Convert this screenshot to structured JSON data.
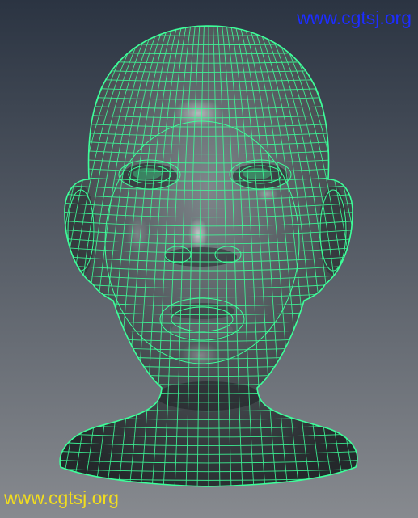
{
  "watermarks": {
    "top_right": "www.cgtsj.org",
    "bottom_left": "www.cgtsj.org"
  },
  "colors": {
    "background_top": "#2b3442",
    "background_bottom": "#878a8f",
    "mesh_wire": "#3dff9a",
    "skin_shade": "#4b5054",
    "top_watermark": "#1d2dff",
    "bottom_watermark": "#f2dd1e"
  },
  "subject": "wireframe-head-model"
}
